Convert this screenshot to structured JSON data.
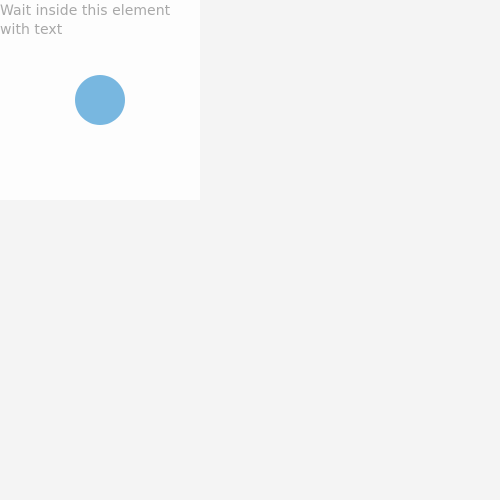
{
  "wait_element": {
    "text": "Wait inside this element with text",
    "circle_color": "#78b7e0",
    "text_color": "#a8a8a8",
    "background_color": "#fdfdfd"
  },
  "page": {
    "background_color": "#f4f4f4"
  }
}
